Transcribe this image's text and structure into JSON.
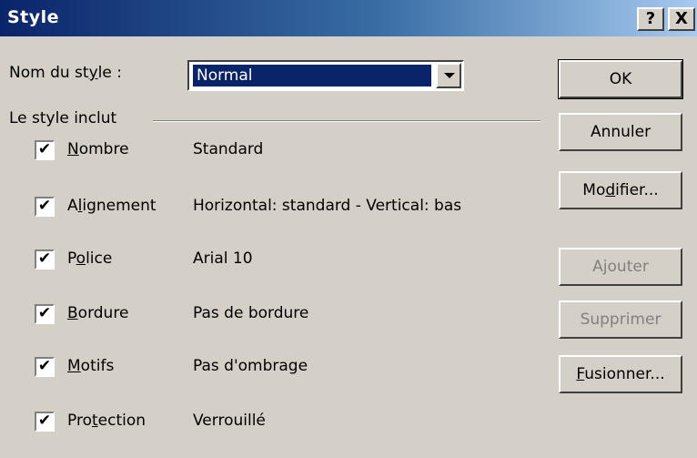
{
  "window": {
    "title": "Style",
    "help_label": "?",
    "close_label": "X"
  },
  "style_name": {
    "label_before": "Nom du st",
    "label_accel": "y",
    "label_after": "le :",
    "value": "Normal"
  },
  "group": {
    "label": "Le style inclut"
  },
  "rows": [
    {
      "checked": true,
      "check": "✔",
      "pre": "",
      "accel": "N",
      "post": "ombre",
      "value": "Standard"
    },
    {
      "checked": true,
      "check": "✔",
      "pre": "A",
      "accel": "l",
      "post": "ignement",
      "value": "Horizontal: standard - Vertical: bas"
    },
    {
      "checked": true,
      "check": "✔",
      "pre": "P",
      "accel": "o",
      "post": "lice",
      "value": "Arial 10"
    },
    {
      "checked": true,
      "check": "✔",
      "pre": "",
      "accel": "B",
      "post": "ordure",
      "value": "Pas de bordure"
    },
    {
      "checked": true,
      "check": "✔",
      "pre": "",
      "accel": "M",
      "post": "otifs",
      "value": "Pas d'ombrage"
    },
    {
      "checked": true,
      "check": "✔",
      "pre": "Pro",
      "accel": "t",
      "post": "ection",
      "value": "Verrouillé"
    }
  ],
  "buttons": {
    "ok": "OK",
    "cancel": "Annuler",
    "modify_pre": "Mo",
    "modify_accel": "d",
    "modify_post": "ifier...",
    "add": "Ajouter",
    "delete": "Supprimer",
    "merge_accel": "F",
    "merge_post": "usionner..."
  }
}
